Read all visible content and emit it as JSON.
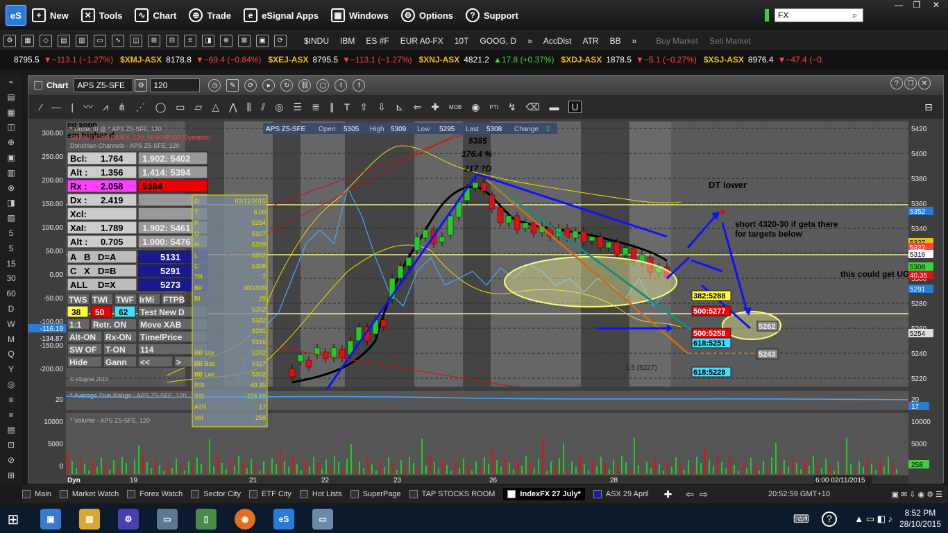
{
  "menu": {
    "logo": "eS",
    "items": [
      "New",
      "Tools",
      "Chart",
      "Trade",
      "eSignal Apps",
      "Windows",
      "Options",
      "Support"
    ],
    "search_value": "FX"
  },
  "toolbar": {
    "symbols": [
      "$INDU",
      "IBM",
      "ES #F",
      "EUR A0-FX",
      "10T",
      "GOOG, D",
      "»",
      "AccDist",
      "ATR",
      "BB",
      "»"
    ],
    "disabled": [
      "Buy Market",
      "Sell Market"
    ]
  },
  "ticker": [
    {
      "name": "",
      "price": "8795.5",
      "chg": "▼−113.1 (−1.27%)",
      "up": false
    },
    {
      "name": "$XMJ-ASX",
      "price": "8178.8",
      "chg": "▼−69.4 (−0.84%)",
      "up": false
    },
    {
      "name": "$XEJ-ASX",
      "price": "8795.5",
      "chg": "▼−113.1 (−1.27%)",
      "up": false
    },
    {
      "name": "$XNJ-ASX",
      "price": "4821.2",
      "chg": "▲17.8 (+0.37%)",
      "up": true
    },
    {
      "name": "$XDJ-ASX",
      "price": "1878.5",
      "chg": "▼−5.1 (−0.27%)",
      "up": false
    },
    {
      "name": "$XSJ-ASX",
      "price": "8976.4",
      "chg": "▼−47.4 (−0.",
      "up": false
    }
  ],
  "leftbar": [
    "5",
    "5",
    "15",
    "30",
    "60",
    "D",
    "W",
    "M",
    "Q",
    "Y"
  ],
  "chart_window": {
    "title": "Chart",
    "symbol": "APS Z5-SFE",
    "interval": "120",
    "header": {
      "symbol": "APS Z5-SFE",
      "open_label": "Open",
      "open": "5305",
      "high_label": "High",
      "high": "5309",
      "low_label": "Low",
      "low": "5295",
      "last_label": "Last",
      "last": "5308",
      "change_label": "Change",
      "change": "2"
    }
  },
  "overlay_text": {
    "left_line1": "ng soon",
    "left_line2": "em higher d",
    "study_line1": "* Under III @ * APS Z5-SFE, 120",
    "study_line2": "S&P/ASX 200 INDEX, 120, 00:00-00:00 (Dynamic)",
    "study_line3": "Donchian Channels - APS Z5-SFE, 120",
    "atr_label": "* Average True Range - APS Z5-SFE, 120",
    "vol_label": "* Volume - APS Z5-SFE, 120",
    "dt_lower": "DT lower",
    "short_note": "short 4320-30  if gets there",
    "short_note2": "for targets below",
    "could_get": "this could get UG",
    "peak_price": "5385",
    "peak_pct": "176.4 %",
    "peak_d": "217 ?D",
    "fib_1": "1.5 (5227)",
    "copyright": "© eSignal 2015",
    "time_cursor": "6:00 02/11/2015",
    "dyn": "Dyn"
  },
  "fib_panel": {
    "rows": [
      [
        "Bcl:",
        "1.764",
        "1.902: 5402"
      ],
      [
        "Alt :",
        "1.356",
        "1.414: 5394"
      ],
      [
        "Rx :",
        "2.058",
        "5384"
      ],
      [
        "Dx :",
        "2.419",
        ""
      ],
      [
        "Xcl:",
        "",
        ""
      ],
      [
        "XaI:",
        "1.789",
        "1.902: 5461"
      ],
      [
        "Alt :",
        "0.705",
        "1.000: 5476"
      ]
    ],
    "assign": [
      [
        "A",
        "B",
        "D=A",
        "5131"
      ],
      [
        "C",
        "X",
        "D=B",
        "5291"
      ],
      [
        "ALL",
        "",
        "D=X",
        "5273"
      ]
    ],
    "buttons1": [
      "TWS",
      "TWI",
      "TWF",
      "IrMi",
      "FTPB"
    ],
    "nums": [
      "38",
      "50",
      "62"
    ],
    "test_new": "Test New D",
    "one_one": "1:1",
    "retr_on": "Retr. ON",
    "move_xab": "Move XAB",
    "alt_on": "Alt-ON",
    "rx_on": "Rx-ON",
    "time_price": "Time/Price",
    "sw_of": "SW OF",
    "t_on": "T-ON",
    "num114": "114",
    "hide": "Hide",
    "gann": "Gann",
    "prev": "<<",
    "next": ">"
  },
  "data_window": {
    "rows": [
      [
        "D",
        "02/11/2015"
      ],
      [
        "T",
        "6:00"
      ],
      [
        "P",
        "5254"
      ],
      [
        "O",
        "5307"
      ],
      [
        "H",
        "5309"
      ],
      [
        "L",
        "5302"
      ],
      [
        "C",
        "5308"
      ],
      [
        "TR",
        "7"
      ],
      [
        "B#",
        "300/300"
      ],
      [
        "BI",
        "29"
      ],
      [
        "",
        "5352"
      ],
      [
        "",
        "5322"
      ],
      [
        "",
        "5291"
      ],
      [
        "",
        "5316"
      ],
      [
        "BB Upr",
        "5352"
      ],
      [
        "BB Bas",
        "5327"
      ],
      [
        "BB Lwr",
        "5302"
      ],
      [
        "RSI",
        "40.35"
      ],
      [
        "SSI",
        "-116.19"
      ],
      [
        "ATR",
        "17"
      ],
      [
        "Vol",
        "258"
      ]
    ]
  },
  "price_axis": {
    "labels": [
      "5420",
      "5400",
      "5380",
      "5360",
      "5340",
      "5320",
      "5300",
      "5280",
      "5260",
      "5240",
      "5220"
    ],
    "tags": [
      {
        "text": "5352",
        "color": "#2a7bd6"
      },
      {
        "text": "5327",
        "color": "#f0c000"
      },
      {
        "text": "5322",
        "color": "#ff4444"
      },
      {
        "text": "5316",
        "color": "#ffffff"
      },
      {
        "text": "5308",
        "color": "#3dd13d"
      },
      {
        "text": "40.35",
        "color": "#d11"
      },
      {
        "text": "5291",
        "color": "#2a7bd6"
      },
      {
        "text": "5254",
        "color": "#dddddd"
      }
    ],
    "atr_labels": [
      "20",
      "17"
    ],
    "vol_labels": [
      "10000",
      "5000",
      "0",
      "258"
    ]
  },
  "osc_axis": {
    "labels": [
      "300.00",
      "250.00",
      "200.00",
      "150.00",
      "100.00",
      "50.00",
      "0.00",
      "-50.00",
      "-100.00",
      "-150.00",
      "-200.00"
    ],
    "tags": [
      "-116.19",
      "-134.87"
    ],
    "atr": "20",
    "vol": [
      "10000",
      "5000",
      "0"
    ]
  },
  "targets": [
    "382:5288",
    "500:5277",
    "500:5258",
    "618:5251",
    "618:5228",
    "5262",
    "5243"
  ],
  "date_axis": [
    "19",
    "21",
    "22",
    "23",
    "26",
    "28"
  ],
  "task_tabs": [
    "Main",
    "Market Watch",
    "Forex Watch",
    "Sector City",
    "ETF City",
    "Hot Lists",
    "SuperPage",
    "TAP STOCKS ROOM",
    "IndexFX 27 July*",
    "ASX 29 April"
  ],
  "tab_clock": "20:52:59 GMT+10",
  "tray": {
    "time": "8:52 PM",
    "date": "28/10/2015"
  }
}
